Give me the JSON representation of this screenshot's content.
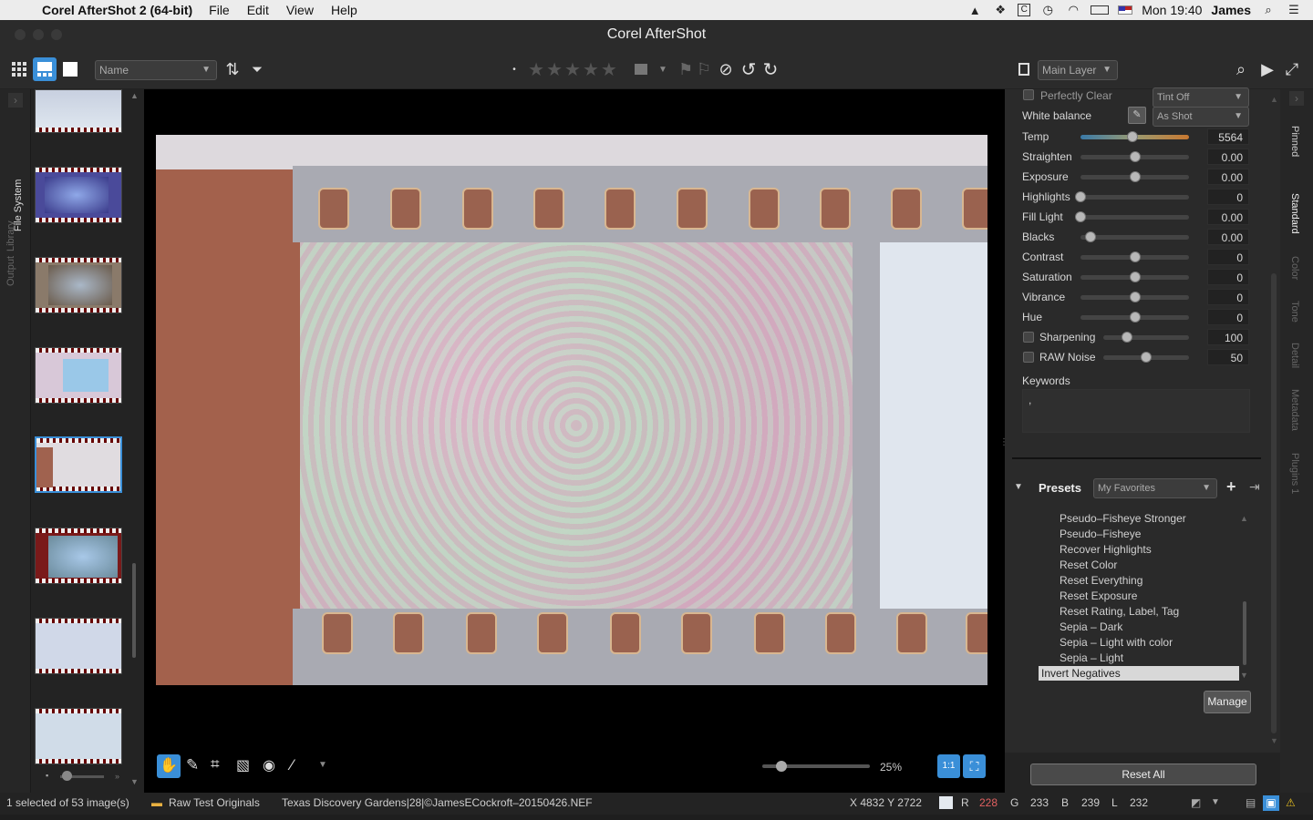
{
  "menubar": {
    "app_name": "Corel AfterShot 2 (64-bit)",
    "menus": [
      "File",
      "Edit",
      "View",
      "Help"
    ],
    "clock": "Mon 19:40",
    "user": "James"
  },
  "window": {
    "title": "Corel AfterShot"
  },
  "toolbar": {
    "sort_select": "Name",
    "layer_select": "Main Layer",
    "rating_stars": 0
  },
  "left_tabs": [
    "Library",
    "File System",
    "Output"
  ],
  "viewer": {
    "zoom": "25%",
    "zoom_level": 0.25
  },
  "adjustments": {
    "perfectly_clear_label": "Perfectly Clear",
    "perfectly_clear_select": "Tint Off",
    "white_balance_label": "White balance",
    "white_balance_select": "As Shot",
    "sliders": [
      {
        "label": "Temp",
        "value": "5564",
        "pos": 0.48
      },
      {
        "label": "Straighten",
        "value": "0.00",
        "pos": 0.5
      },
      {
        "label": "Exposure",
        "value": "0.00",
        "pos": 0.5
      },
      {
        "label": "Highlights",
        "value": "0",
        "pos": 0.0
      },
      {
        "label": "Fill Light",
        "value": "0.00",
        "pos": 0.0
      },
      {
        "label": "Blacks",
        "value": "0.00",
        "pos": 0.09
      },
      {
        "label": "Contrast",
        "value": "0",
        "pos": 0.5
      },
      {
        "label": "Saturation",
        "value": "0",
        "pos": 0.5
      },
      {
        "label": "Vibrance",
        "value": "0",
        "pos": 0.5
      },
      {
        "label": "Hue",
        "value": "0",
        "pos": 0.5
      }
    ],
    "sharpening_label": "Sharpening",
    "sharpening_value": "100",
    "raw_noise_label": "RAW Noise",
    "raw_noise_value": "50",
    "keywords_label": "Keywords",
    "keywords_value": ","
  },
  "presets": {
    "title": "Presets",
    "select": "My Favorites",
    "items": [
      "Pseudo–Fisheye Stronger",
      "Pseudo–Fisheye",
      "Recover Highlights",
      "Reset Color",
      "Reset Everything",
      "Reset Exposure",
      "Reset Rating, Label, Tag",
      "Sepia – Dark",
      "Sepia – Light  with color",
      "Sepia – Light"
    ],
    "selected_item": "Invert Negatives",
    "manage_label": "Manage"
  },
  "reset_all_label": "Reset All",
  "right_tabs": [
    "Pinned",
    "Standard",
    "Color",
    "Tone",
    "Detail",
    "Metadata",
    "Plugins 1"
  ],
  "status": {
    "selection": "1 selected of 53 image(s)",
    "folder": "Raw Test Originals",
    "filename": "Texas Discovery Gardens|28|©JamesECockroft–20150426.NEF",
    "coords": "X 4832  Y 2722",
    "r_label": "R",
    "r_value": "228",
    "g_label": "G",
    "g_value": "233",
    "b_label": "B",
    "b_value": "239",
    "l_label": "L",
    "l_value": "232"
  },
  "colors": {
    "accent": "#3a8fd8",
    "red_value": "#e06060",
    "orange_track": "#c87830"
  }
}
